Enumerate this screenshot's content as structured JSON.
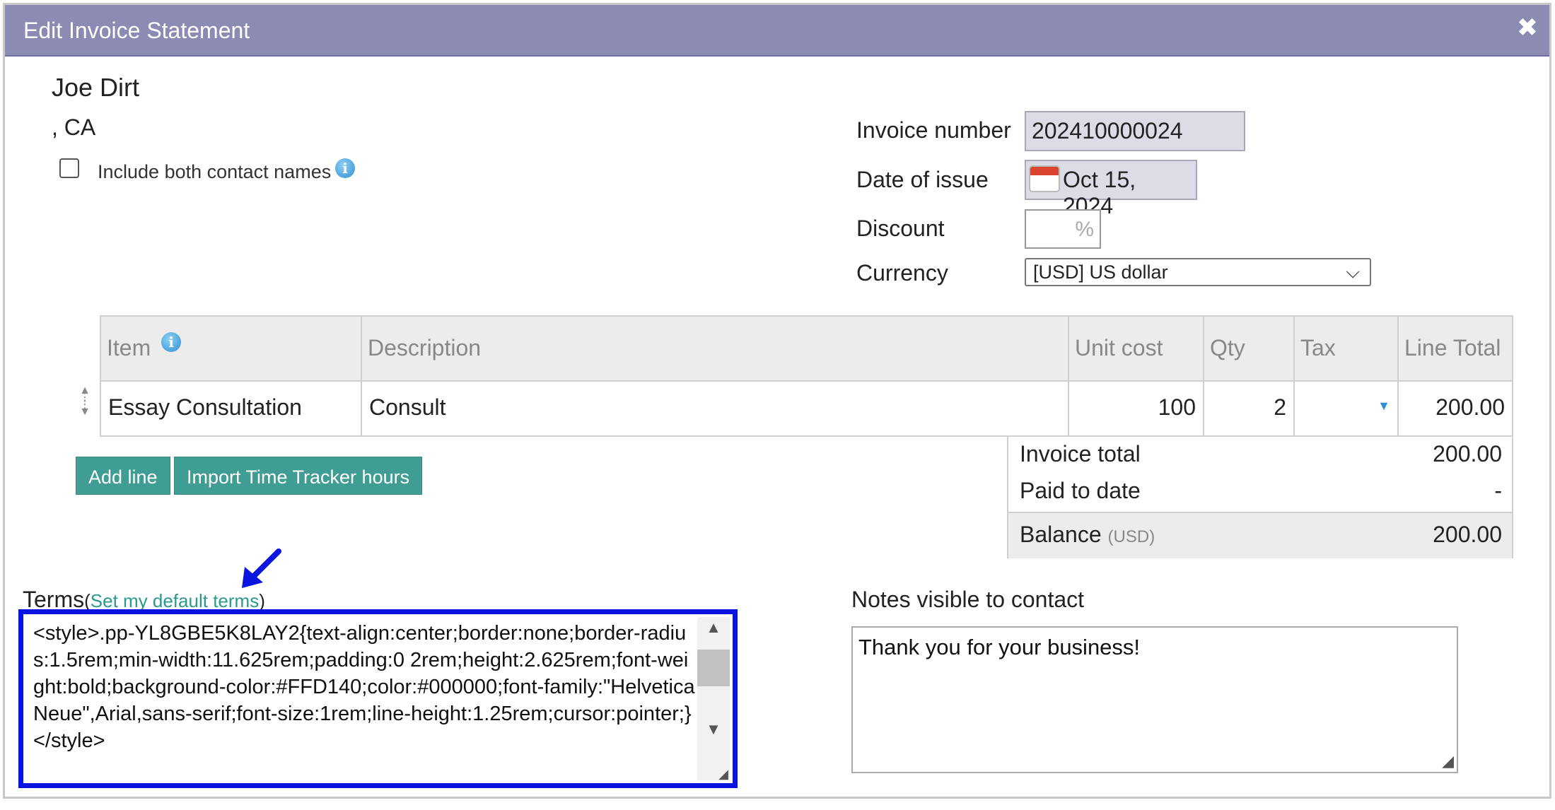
{
  "dialog": {
    "title": "Edit Invoice Statement",
    "close_icon": "close-icon"
  },
  "contact": {
    "name": "Joe Dirt",
    "region": ", CA",
    "include_both_label": "Include both contact names",
    "include_both_checked": false
  },
  "fields": {
    "invoice_number_label": "Invoice number",
    "invoice_number": "202410000024",
    "date_label": "Date of issue",
    "date": "Oct 15, 2024",
    "discount_label": "Discount",
    "discount_suffix": "%",
    "discount_value": "",
    "currency_label": "Currency",
    "currency": "[USD] US dollar"
  },
  "table": {
    "headers": [
      "Item",
      "Description",
      "Unit cost",
      "Qty",
      "Tax",
      "Line Total"
    ],
    "rows": [
      {
        "item": "Essay Consultation",
        "description": "Consult",
        "unit_cost": "100",
        "qty": "2",
        "tax": "",
        "line_total": "200.00"
      }
    ]
  },
  "buttons": {
    "add_line": "Add line",
    "import_time": "Import Time Tracker hours"
  },
  "totals": {
    "invoice_total_label": "Invoice total",
    "invoice_total": "200.00",
    "paid_label": "Paid to date",
    "paid": "-",
    "balance_label": "Balance",
    "balance_currency": "(USD)",
    "balance": "200.00"
  },
  "terms": {
    "label": "Terms",
    "open_paren": "(",
    "link": "Set my default terms",
    "close_paren": ")",
    "text": "<style>.pp-YL8GBE5K8LAY2{text-align:center;border:none;border-radius:1.5rem;min-width:11.625rem;padding:0 2rem;height:2.625rem;font-weight:bold;background-color:#FFD140;color:#000000;font-family:\"Helvetica Neue\",Arial,sans-serif;font-size:1rem;line-height:1.25rem;cursor:pointer;}</style>"
  },
  "notes": {
    "label": "Notes visible to contact",
    "text": "Thank you for your business!"
  },
  "colors": {
    "titlebar": "#8b8bb4",
    "button": "#3f9d94",
    "highlight_border": "#0a14e0",
    "link": "#2a9a8f"
  }
}
